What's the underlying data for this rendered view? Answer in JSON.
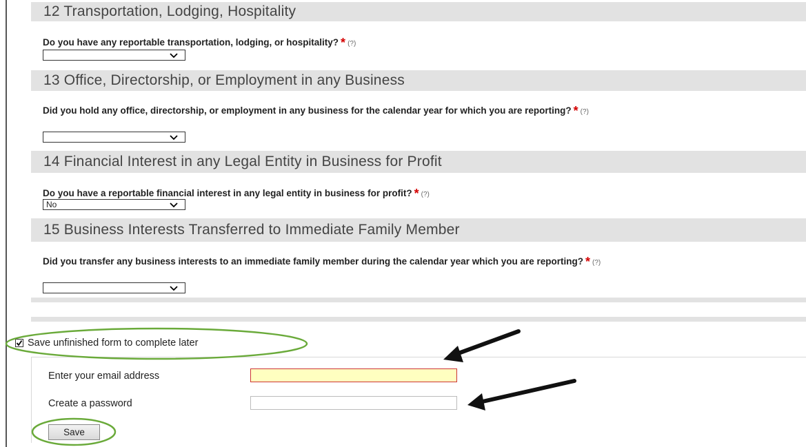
{
  "sections": [
    {
      "title": "12 Transportation, Lodging, Hospitality",
      "question": "Do you have any reportable transportation, lodging, or hospitality?",
      "help": "(?)",
      "selected": ""
    },
    {
      "title": "13 Office, Directorship, or Employment in any Business",
      "question": "Did you hold any office, directorship, or employment in any business for the calendar year for which you are reporting?",
      "help": "(?)",
      "selected": ""
    },
    {
      "title": "14 Financial Interest in any Legal Entity in Business for Profit",
      "question": "Do you have a reportable financial interest in any legal entity in business for profit?",
      "help": "(?)",
      "selected": "No"
    },
    {
      "title": "15 Business Interests Transferred to Immediate Family Member",
      "question": "Did you transfer any business interests to an immediate family member during the calendar year which you are reporting?",
      "help": "(?)",
      "selected": ""
    }
  ],
  "required_marker": "*",
  "save_form": {
    "checkbox_label": "Save unfinished form to complete later",
    "checked": true,
    "email_label": "Enter your email address",
    "email_value": "",
    "password_label": "Create a password",
    "password_value": "",
    "save_button": "Save"
  },
  "colors": {
    "section_header_bg": "#e2e2e2",
    "required": "#d40000",
    "highlight_circle": "#6aaa3a",
    "email_field_bg": "#ffffc0",
    "email_field_border": "#cc3333",
    "arrow": "#111111"
  }
}
